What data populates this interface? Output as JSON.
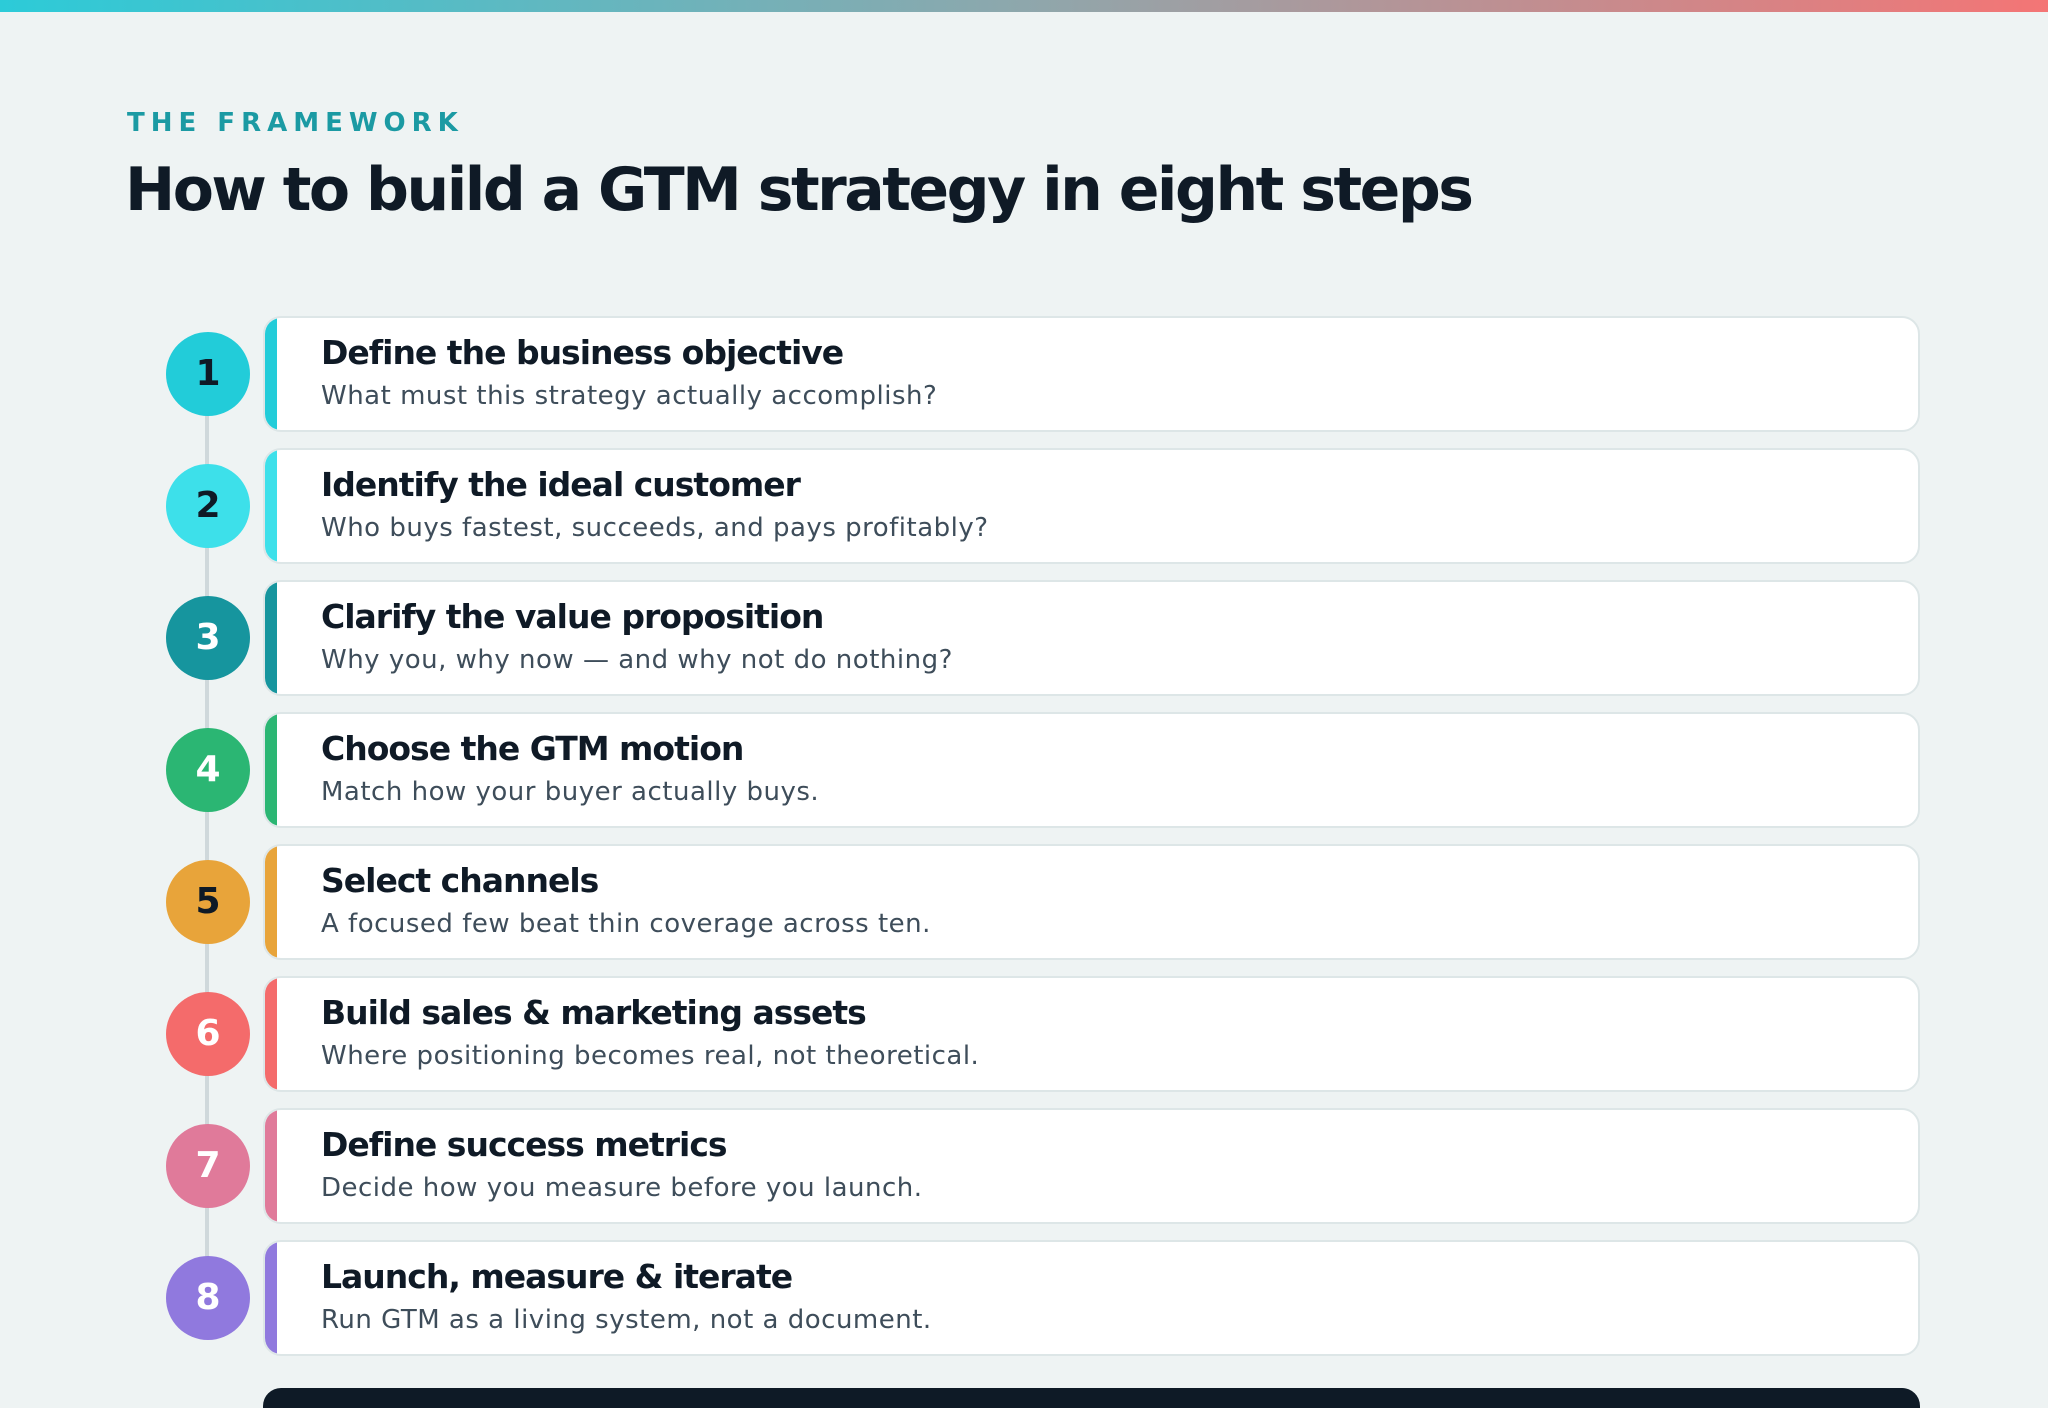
{
  "header": {
    "eyebrow": "THE FRAMEWORK",
    "title": "How to build a GTM strategy in eight steps"
  },
  "colors": {
    "top_bar_start": "#2ccbd8",
    "top_bar_end": "#f47575",
    "eyebrow": "#1b9aa3",
    "title": "#0f1a26",
    "background": "#eef3f3"
  },
  "steps": [
    {
      "number": "1",
      "title": "Define the business objective",
      "description": "What must this strategy actually accomplish?",
      "color": "#22ccd9",
      "number_color": "#0f1a26"
    },
    {
      "number": "2",
      "title": "Identify the ideal customer",
      "description": "Who buys fastest, succeeds, and pays profitably?",
      "color": "#3de0ea",
      "number_color": "#0f1a26"
    },
    {
      "number": "3",
      "title": "Clarify the value proposition",
      "description": "Why you, why now — and why not do nothing?",
      "color": "#16959e",
      "number_color": "#ffffff"
    },
    {
      "number": "4",
      "title": "Choose the GTM motion",
      "description": "Match how your buyer actually buys.",
      "color": "#2bb673",
      "number_color": "#ffffff"
    },
    {
      "number": "5",
      "title": "Select channels",
      "description": "A focused few beat thin coverage across ten.",
      "color": "#e8a43a",
      "number_color": "#0f1a26"
    },
    {
      "number": "6",
      "title": "Build sales & marketing assets",
      "description": "Where positioning becomes real, not theoretical.",
      "color": "#f46b6b",
      "number_color": "#ffffff"
    },
    {
      "number": "7",
      "title": "Define success metrics",
      "description": "Decide how you measure before you launch.",
      "color": "#e07a9a",
      "number_color": "#ffffff"
    },
    {
      "number": "8",
      "title": "Launch, measure & iterate",
      "description": "Run GTM as a living system, not a document.",
      "color": "#9079de",
      "number_color": "#ffffff"
    }
  ]
}
